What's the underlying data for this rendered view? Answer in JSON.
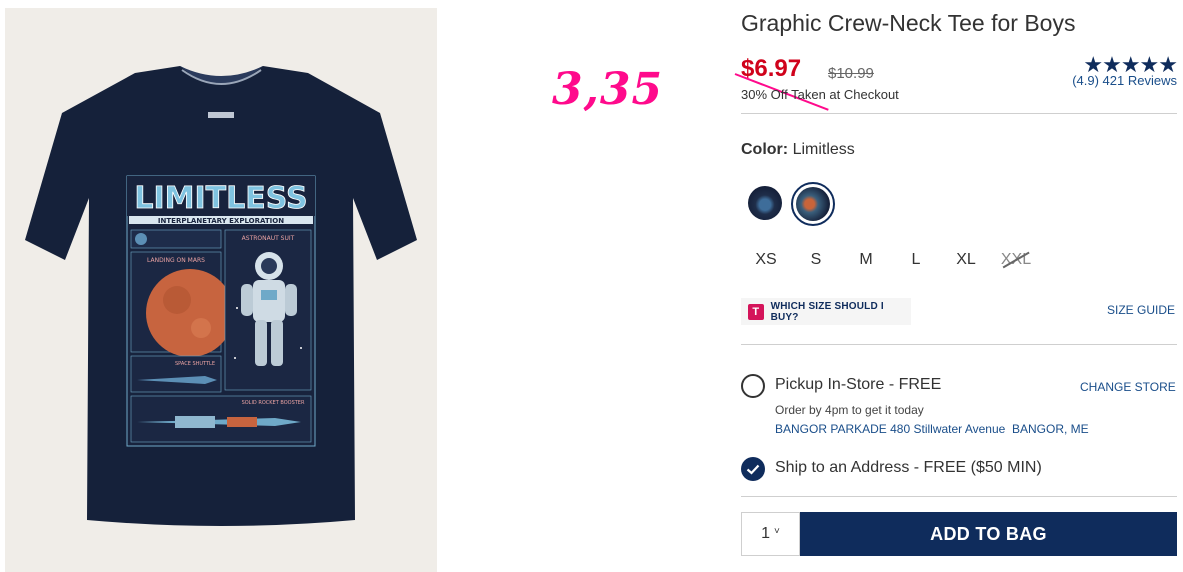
{
  "product": {
    "title": "Graphic Crew-Neck Tee for Boys",
    "sale_price": "$6.97",
    "original_price": "$10.99",
    "discount_note": "30% Off Taken at Checkout",
    "rating_stars": "★★★★★",
    "rating_text": "(4.9) 421 Reviews",
    "image_graphic": {
      "headline": "LIMITLESS",
      "subhead": "INTERPLANETARY EXPLORATION",
      "panel_labels": [
        "ASTRONAUT SUIT",
        "LANDING ON MARS",
        "SPACE SHUTTLE",
        "SOLID ROCKET BOOSTER"
      ]
    }
  },
  "annotation": {
    "text": "3,35",
    "color": "#ff0a8c"
  },
  "color": {
    "label": "Color:",
    "value": "Limitless"
  },
  "sizes": [
    {
      "label": "XS",
      "available": true
    },
    {
      "label": "S",
      "available": true
    },
    {
      "label": "M",
      "available": true
    },
    {
      "label": "L",
      "available": true
    },
    {
      "label": "XL",
      "available": true
    },
    {
      "label": "XXL",
      "available": false
    }
  ],
  "size_help": {
    "icon_letter": "T",
    "label": "WHICH SIZE SHOULD I BUY?",
    "guide": "SIZE GUIDE"
  },
  "fulfillment": {
    "pickup_title": "Pickup In-Store - FREE",
    "change_store": "CHANGE STORE",
    "pickup_sub": "Order by 4pm to get it today",
    "store": "BANGOR PARKADE 480 Stillwater Avenue  BANGOR, ME",
    "ship_title": "Ship to an Address - FREE ($50 MIN)"
  },
  "cart": {
    "quantity": "1",
    "add_label": "ADD TO BAG"
  },
  "colors": {
    "navy": "#0f2c5c",
    "sale_red": "#d0021b",
    "link_blue": "#1a4e8a",
    "annotation_pink": "#ff0a8c"
  }
}
